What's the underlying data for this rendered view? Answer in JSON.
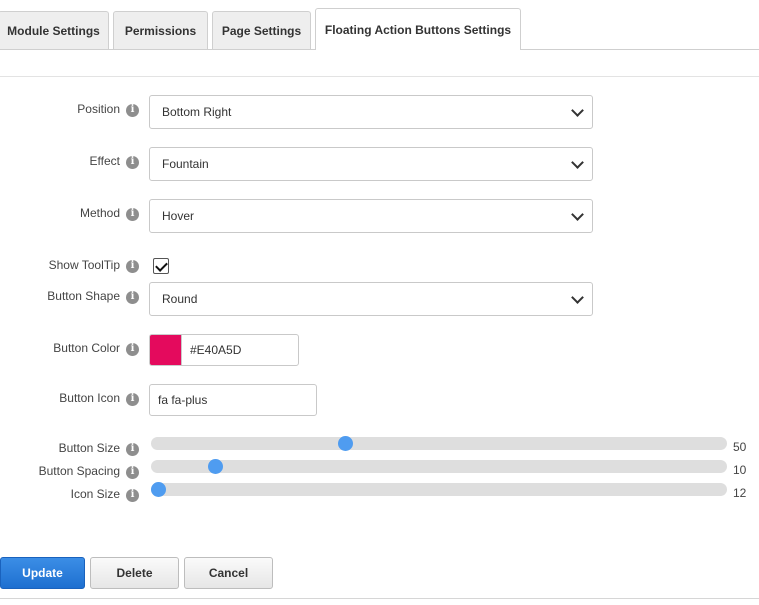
{
  "tabs": [
    {
      "label": "Module Settings",
      "active": false
    },
    {
      "label": "Permissions",
      "active": false
    },
    {
      "label": "Page Settings",
      "active": false
    },
    {
      "label": "Floating Action Buttons Settings",
      "active": true
    }
  ],
  "form": {
    "position": {
      "label": "Position",
      "value": "Bottom Right"
    },
    "effect": {
      "label": "Effect",
      "value": "Fountain"
    },
    "method": {
      "label": "Method",
      "value": "Hover"
    },
    "show_tooltip": {
      "label": "Show ToolTip",
      "checked": true
    },
    "button_shape": {
      "label": "Button Shape",
      "value": "Round"
    },
    "button_color": {
      "label": "Button Color",
      "value": "#E40A5D",
      "swatch": "#E40A5D"
    },
    "button_icon": {
      "label": "Button Icon",
      "value": "fa fa-plus"
    },
    "button_size": {
      "label": "Button Size",
      "value": "50",
      "fraction": 0.336
    },
    "button_spacing": {
      "label": "Button Spacing",
      "value": "10",
      "fraction": 0.111
    },
    "icon_size": {
      "label": "Icon Size",
      "value": "12",
      "fraction": 0.012
    }
  },
  "info_icon_glyph": "i",
  "actions": {
    "update": "Update",
    "delete": "Delete",
    "cancel": "Cancel"
  },
  "colors": {
    "primary": "#1E6FD0",
    "slider_thumb": "#4F9CF0"
  }
}
